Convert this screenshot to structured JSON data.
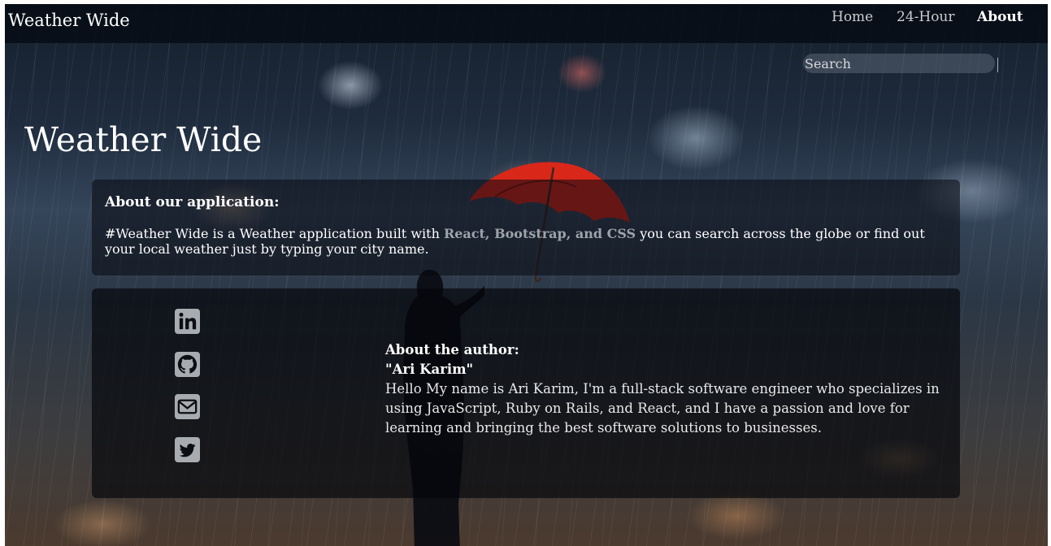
{
  "navbar": {
    "brand": "Weather Wide",
    "links": [
      {
        "label": "Home",
        "active": false
      },
      {
        "label": "24-Hour",
        "active": false
      },
      {
        "label": "About",
        "active": true
      }
    ]
  },
  "search": {
    "placeholder": "Search",
    "value": ""
  },
  "hero": {
    "title": "Weather Wide"
  },
  "about_app": {
    "heading": "About our application:",
    "text_before": "#Weather Wide is a Weather application built with ",
    "tech": "React, Bootstrap, and CSS",
    "text_after": " you can search across the globe or find out your local weather just by typing your city name."
  },
  "about_author": {
    "heading": "About the author:",
    "name": "\"Ari Karim\"",
    "bio": "Hello My name is Ari Karim, I'm a full-stack software engineer who specializes in using JavaScript, Ruby on Rails, and React, and I have a passion and love for learning and bringing the best software solutions to businesses."
  },
  "social_links": [
    "linkedin-icon",
    "github-icon",
    "email-icon",
    "twitter-icon"
  ],
  "colors": {
    "icon": "#a8abaf",
    "umbrella": "#d9271a",
    "muted_tech": "#9fa3aa"
  }
}
